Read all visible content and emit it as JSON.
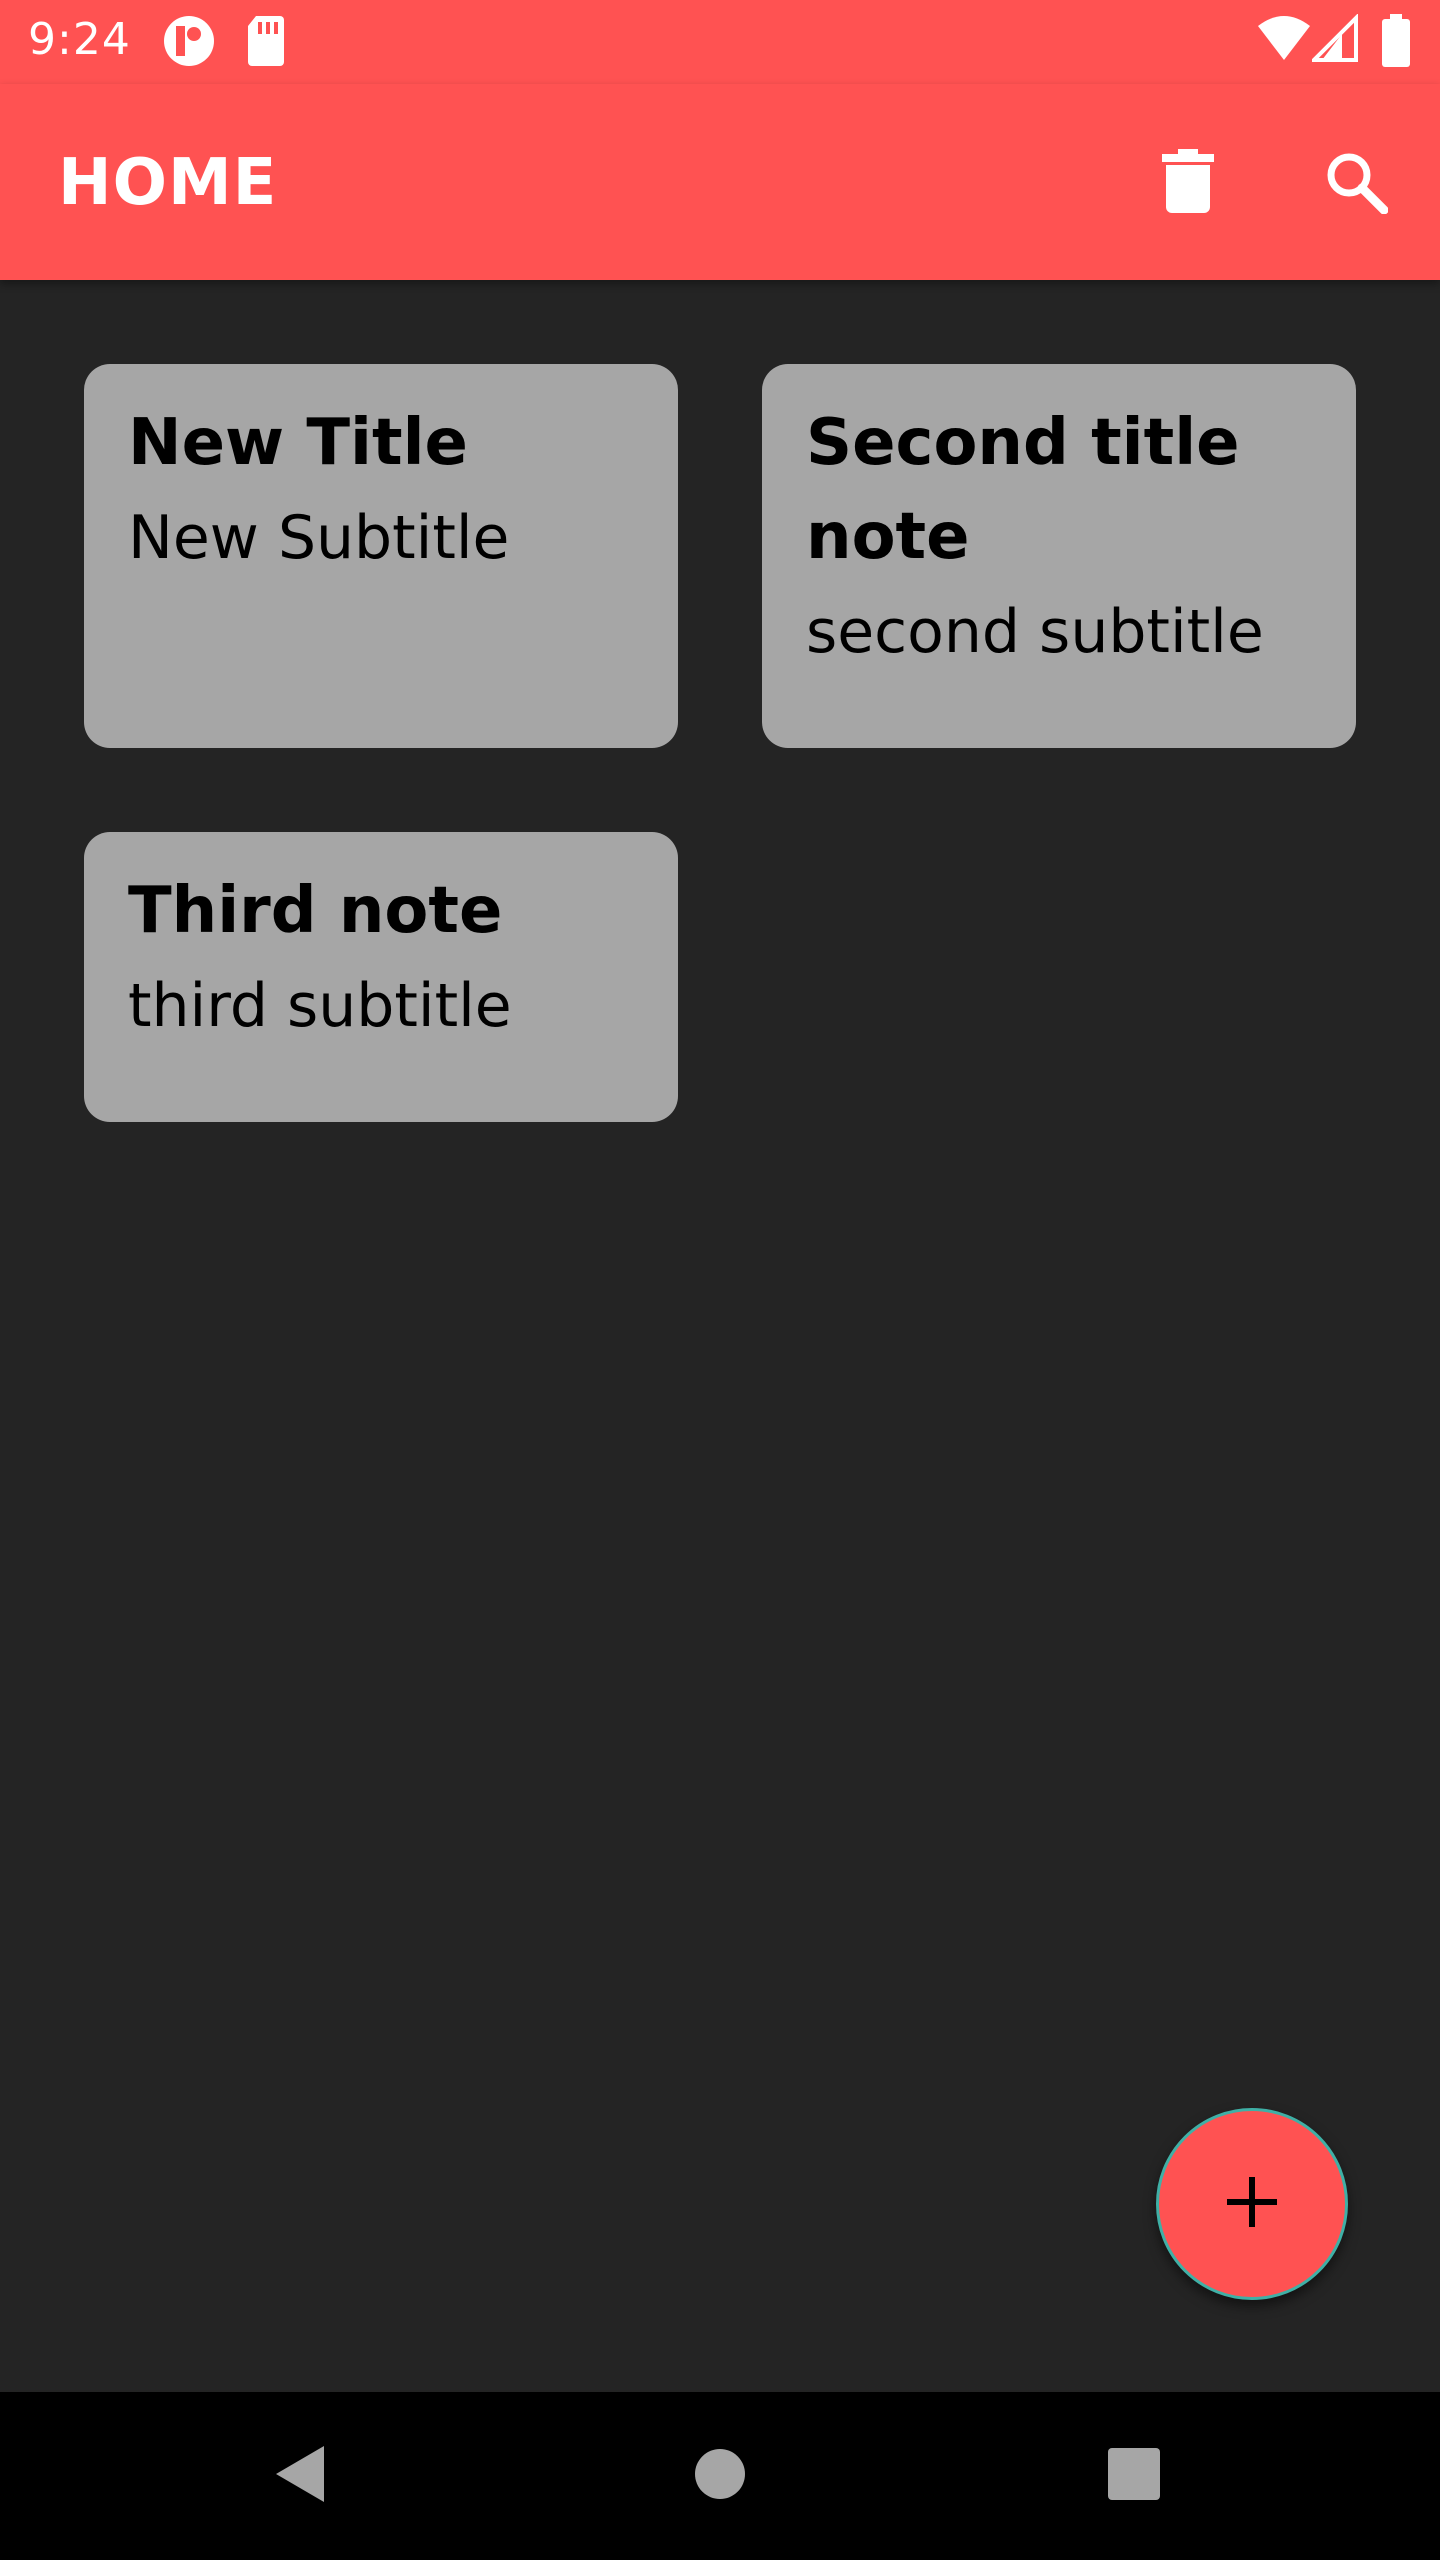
{
  "status_bar": {
    "time": "9:24",
    "icons": [
      "notification-app-icon",
      "sd-card-icon",
      "wifi-icon",
      "cell-signal-icon",
      "battery-icon"
    ]
  },
  "app_bar": {
    "title": "HOME",
    "actions": [
      "delete-icon",
      "search-icon"
    ]
  },
  "notes": [
    {
      "title": "New Title",
      "subtitle": "New Subtitle"
    },
    {
      "title": "Second title note",
      "subtitle": "second subtitle"
    },
    {
      "title": "Third note",
      "subtitle": "third subtitle"
    }
  ],
  "fab": {
    "icon": "plus-icon"
  },
  "nav_bar": {
    "buttons": [
      "back-icon",
      "home-icon",
      "recents-icon"
    ]
  },
  "colors": {
    "accent": "#ff5252",
    "background": "#242424",
    "card": "#a6a6a6",
    "fab_border": "#3fb0a6"
  }
}
